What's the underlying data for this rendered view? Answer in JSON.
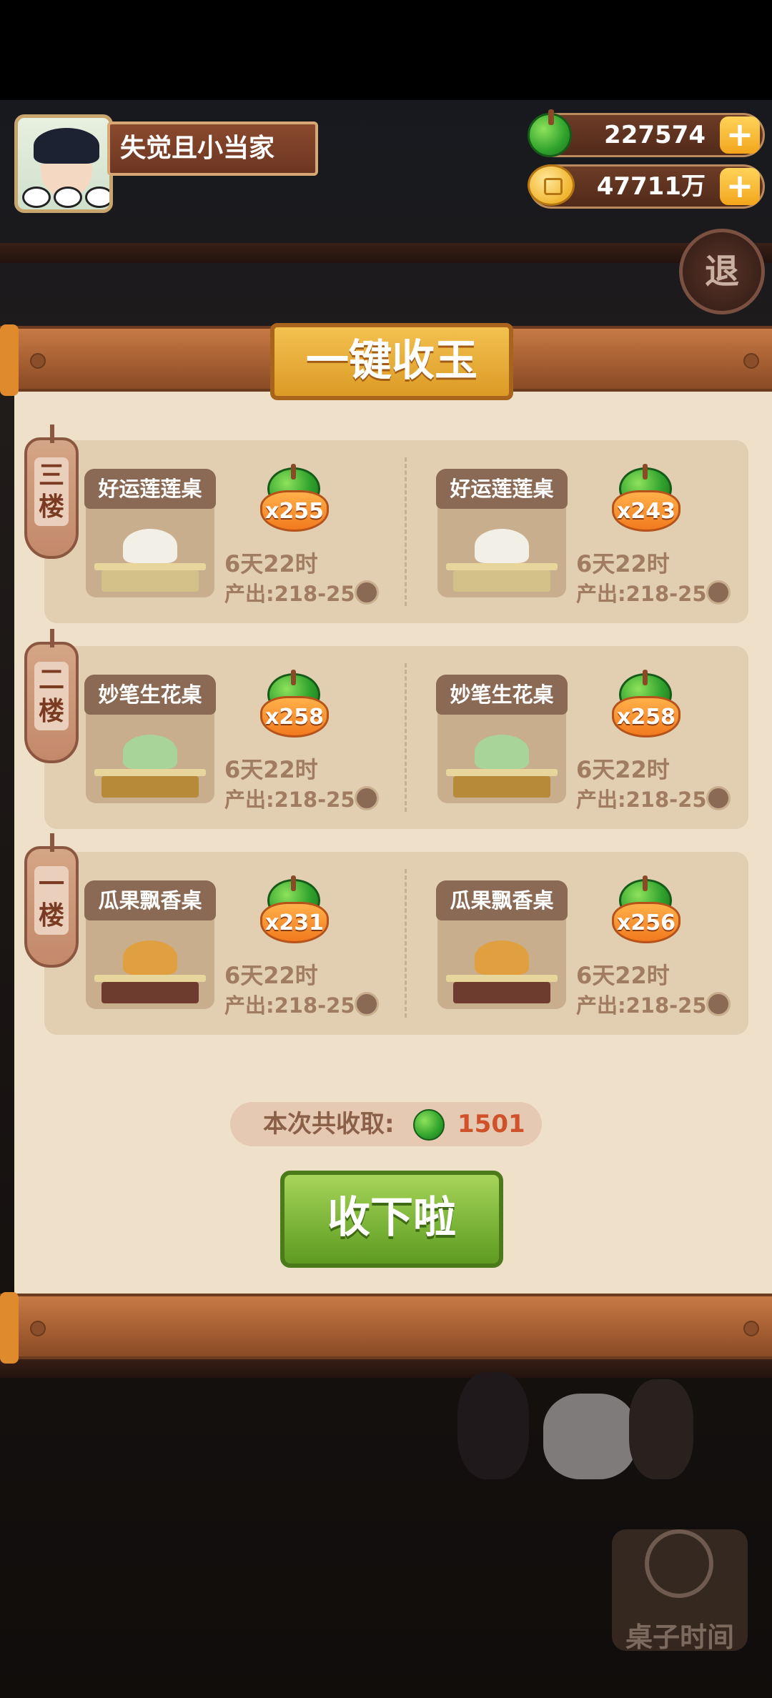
{
  "player": {
    "name": "失觉且小当家"
  },
  "resources": {
    "jade": {
      "value": "227574",
      "icon": "jade-icon",
      "color": "#2fa22c"
    },
    "coins": {
      "value": "47711万",
      "icon": "coin-icon",
      "color": "#f1b631"
    },
    "add_label": "+"
  },
  "exit_label": "退",
  "panel": {
    "title": "一键收玉",
    "floors": [
      {
        "label": "三楼",
        "tables": [
          {
            "name": "好运莲莲桌",
            "count": "x255",
            "time": "6天22时",
            "output": "产出:218-258"
          },
          {
            "name": "好运莲莲桌",
            "count": "x243",
            "time": "6天22时",
            "output": "产出:218-258"
          }
        ]
      },
      {
        "label": "二楼",
        "tables": [
          {
            "name": "妙笔生花桌",
            "count": "x258",
            "time": "6天22时",
            "output": "产出:218-258"
          },
          {
            "name": "妙笔生花桌",
            "count": "x258",
            "time": "6天22时",
            "output": "产出:218-258"
          }
        ]
      },
      {
        "label": "一楼",
        "tables": [
          {
            "name": "瓜果飘香桌",
            "count": "x231",
            "time": "6天22时",
            "output": "产出:218-258"
          },
          {
            "name": "瓜果飘香桌",
            "count": "x256",
            "time": "6天22时",
            "output": "产出:218-258"
          }
        ]
      }
    ],
    "total_label": "本次共收取:",
    "total_value": "1501",
    "collect_button": "收下啦"
  },
  "table_time_button": "桌子时间"
}
